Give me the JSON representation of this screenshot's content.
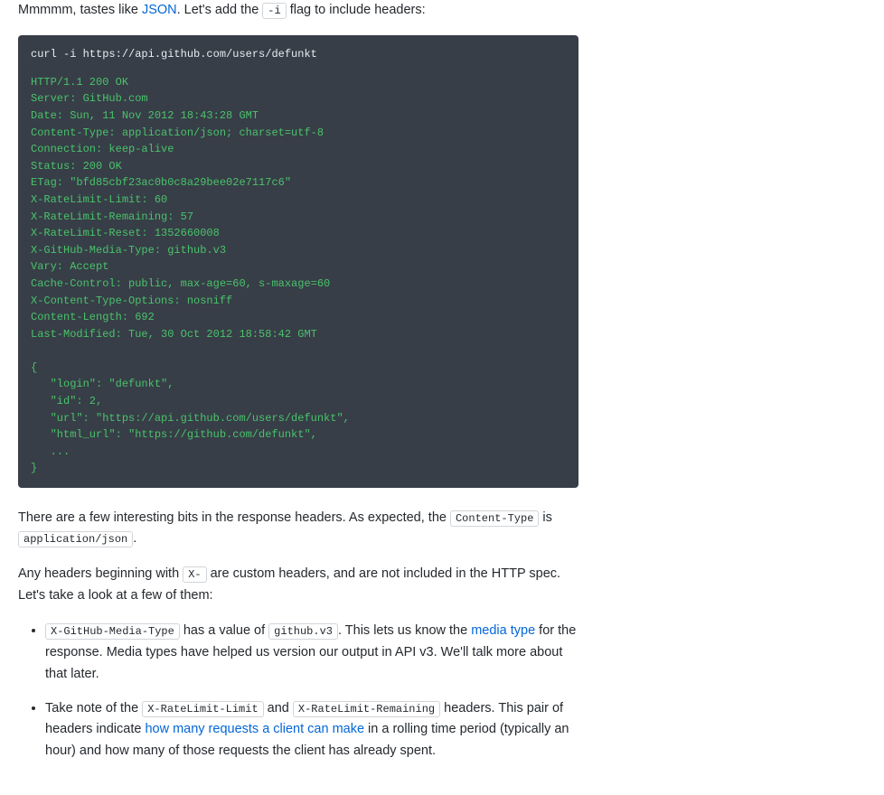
{
  "para1": {
    "t1": "Mmmmm, tastes like ",
    "link1": "JSON",
    "t2": ". Let's add the ",
    "code1": "-i",
    "t3": " flag to include headers:"
  },
  "code": {
    "command": "curl -i https://api.github.com/users/defunkt",
    "output": "HTTP/1.1 200 OK\nServer: GitHub.com\nDate: Sun, 11 Nov 2012 18:43:28 GMT\nContent-Type: application/json; charset=utf-8\nConnection: keep-alive\nStatus: 200 OK\nETag: \"bfd85cbf23ac0b0c8a29bee02e7117c6\"\nX-RateLimit-Limit: 60\nX-RateLimit-Remaining: 57\nX-RateLimit-Reset: 1352660008\nX-GitHub-Media-Type: github.v3\nVary: Accept\nCache-Control: public, max-age=60, s-maxage=60\nX-Content-Type-Options: nosniff\nContent-Length: 692\nLast-Modified: Tue, 30 Oct 2012 18:58:42 GMT\n\n{\n   \"login\": \"defunkt\",\n   \"id\": 2,\n   \"url\": \"https://api.github.com/users/defunkt\",\n   \"html_url\": \"https://github.com/defunkt\",\n   ...\n}"
  },
  "para2": {
    "t1": "There are a few interesting bits in the response headers. As expected, the ",
    "code1": "Content-Type",
    "t2": " is ",
    "code2": "application/json",
    "t3": "."
  },
  "para3": {
    "t1": "Any headers beginning with ",
    "code1": "X-",
    "t2": " are custom headers, and are not included in the HTTP spec. Let's take a look at a few of them:"
  },
  "li1": {
    "code1": "X-GitHub-Media-Type",
    "t1": " has a value of ",
    "code2": "github.v3",
    "t2": ". This lets us know the ",
    "link1": "media type",
    "t3": " for the response. Media types have helped us version our output in API v3. We'll talk more about that later."
  },
  "li2": {
    "t1": "Take note of the ",
    "code1": "X-RateLimit-Limit",
    "t2": " and ",
    "code2": "X-RateLimit-Remaining",
    "t3": " headers. This pair of headers indicate ",
    "link1": "how many requests a client can make",
    "t4": " in a rolling time period (typically an hour) and how many of those requests the client has already spent."
  }
}
